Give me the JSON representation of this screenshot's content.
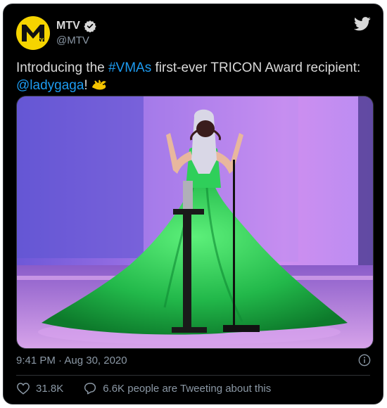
{
  "author": {
    "name": "MTV",
    "handle": "@MTV",
    "avatar_text": "MTV",
    "verified_icon": "verified-badge-icon"
  },
  "tweet": {
    "text_before": "Introducing the ",
    "hashtag": "#VMAs",
    "text_middle": " first-ever TRICON Award recipient: ",
    "mention": "@ladygaga",
    "text_after": "!",
    "emoji": "dragon-emoji"
  },
  "media": {
    "description_icon": "photo-lady-gaga-green-gown"
  },
  "timestamp": "9:41 PM · Aug 30, 2020",
  "actions": {
    "likes": "31.8K",
    "replies_label": "6.6K people are Tweeting about this"
  },
  "colors": {
    "background": "#000000",
    "text": "#d9d9d9",
    "muted": "#8b98a5",
    "link": "#1d9bf0",
    "mtv_yellow": "#f5d400"
  }
}
